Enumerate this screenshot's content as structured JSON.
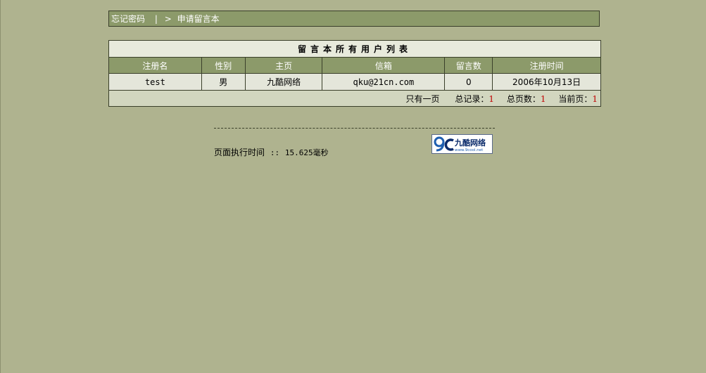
{
  "nav": {
    "forgot_password": "忘记密码",
    "separator": "|",
    "arrow": ">",
    "apply": "申请留言本"
  },
  "table": {
    "title": "留言本所有用户列表",
    "headers": [
      "注册名",
      "性别",
      "主页",
      "信箱",
      "留言数",
      "注册时间"
    ],
    "rows": [
      {
        "name": "test",
        "gender": "男",
        "homepage": "九酷网络",
        "email": "qku@21cn.com",
        "count": "0",
        "reg_time": "2006年10月13日"
      }
    ]
  },
  "pager": {
    "only_one_page": "只有一页",
    "total_records_label": "总记录：",
    "total_records": "1",
    "total_pages_label": "总页数：",
    "total_pages": "1",
    "current_page_label": "当前页：",
    "current_page": "1"
  },
  "footer": {
    "exec_label": "页面执行时间",
    "exec_sep": "::",
    "exec_value": "15.625毫秒"
  },
  "logo": {
    "mark": "9C",
    "text": "九酷网络",
    "url_text": "www.9cool.net",
    "colors": {
      "blue": "#1f5fb0",
      "dark": "#0a2a6a"
    }
  },
  "colors": {
    "page_bg": "#afb38f",
    "bar_bg": "#8c9a6a",
    "red_num": "#c00000"
  }
}
